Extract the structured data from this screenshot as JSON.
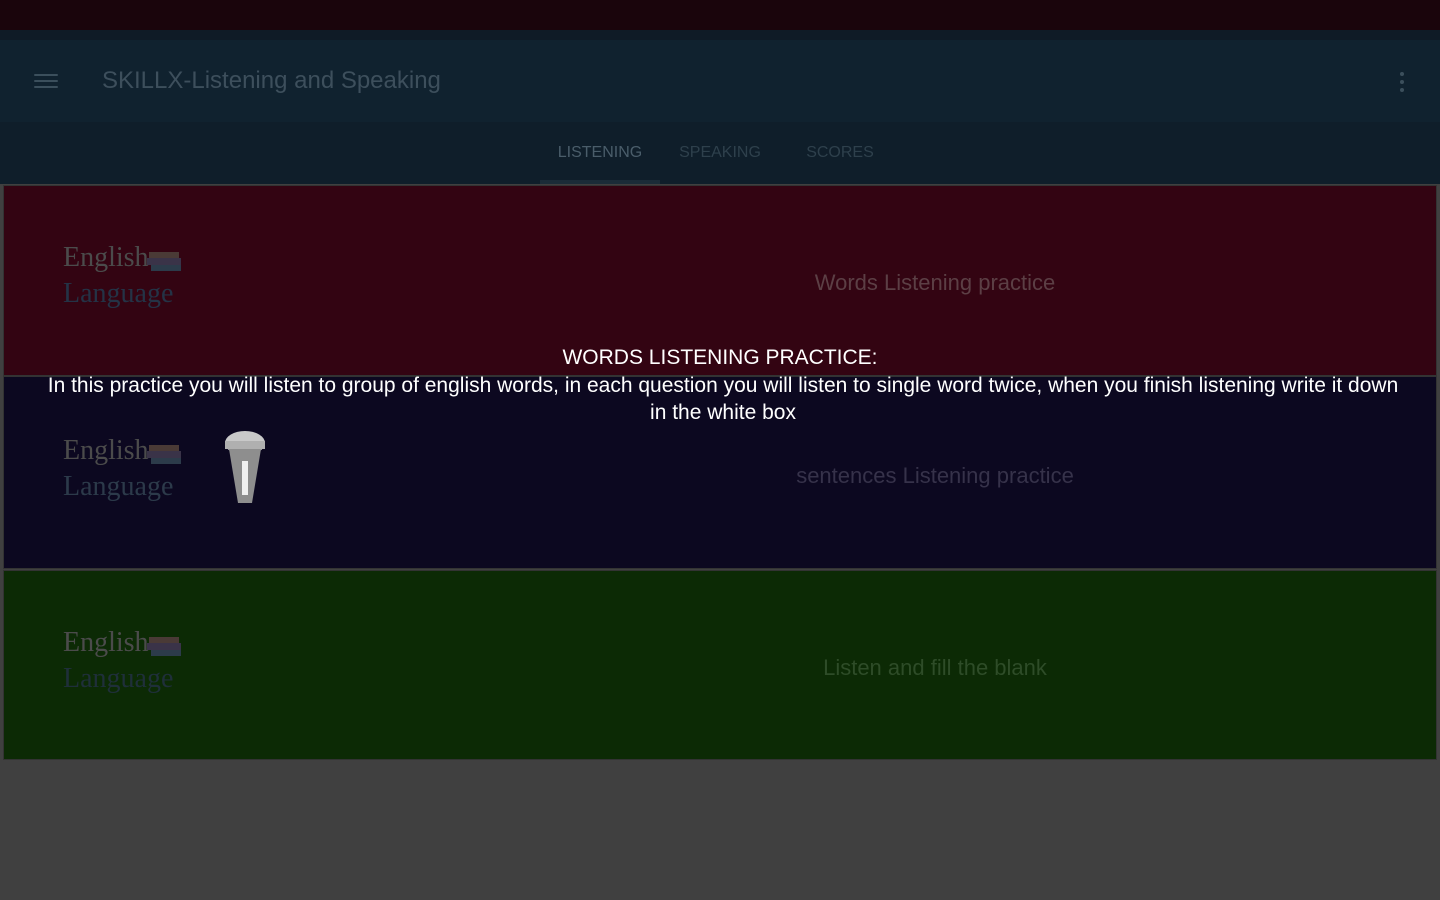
{
  "app_bar": {
    "title": "SKILLX-Listening and Speaking",
    "menu_icon": "hamburger-menu-icon",
    "overflow_icon": "more-vert-icon"
  },
  "tabs": [
    {
      "label": "LISTENING",
      "active": true
    },
    {
      "label": "SPEAKING",
      "active": false
    },
    {
      "label": "SCORES",
      "active": false
    }
  ],
  "cards": [
    {
      "label": "Words Listening practice",
      "logo_line1": "English",
      "logo_line2": "Language",
      "color": "#330412"
    },
    {
      "label": "sentences Listening practice",
      "logo_line1": "English",
      "logo_line2": "Language",
      "color": "#0c0820"
    },
    {
      "label": "Listen and fill the blank",
      "logo_line1": "English",
      "logo_line2": "Language",
      "color": "#0c2a05"
    }
  ],
  "overlay": {
    "title": "WORDS LISTENING PRACTICE:",
    "body": "In this practice you will listen to group of english words, in each question you will listen to single word twice, when you finish listening write it down in the white box",
    "icon": "microphone-icon"
  }
}
